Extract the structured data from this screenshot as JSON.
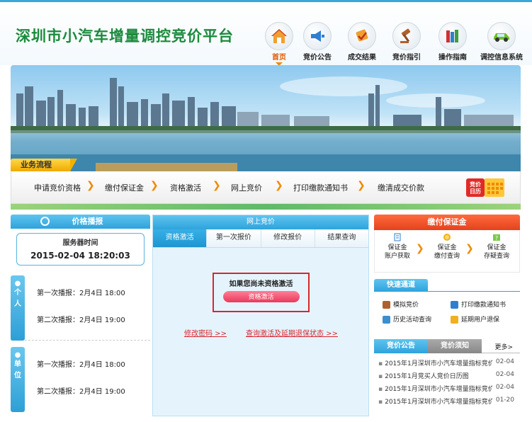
{
  "header": {
    "title": "深圳市小汽车增量调控竞价平台",
    "nav": [
      {
        "label": "首页",
        "icon": "house-icon",
        "active": true
      },
      {
        "label": "竞价公告",
        "icon": "megaphone-icon"
      },
      {
        "label": "成交结果",
        "icon": "trophy-icon"
      },
      {
        "label": "竞价指引",
        "icon": "gavel-icon"
      },
      {
        "label": "操作指南",
        "icon": "books-icon"
      },
      {
        "label": "调控信息系统",
        "icon": "car-icon"
      }
    ]
  },
  "process": {
    "tab_label": "业务流程",
    "steps": [
      "申请竞价资格",
      "缴付保证金",
      "资格激活",
      "网上竞价",
      "打印缴款通知书",
      "缴清成交价款"
    ],
    "calendar_label_1": "竞价",
    "calendar_label_2": "日历"
  },
  "left": {
    "head": "价格播报",
    "server_label": "服务器时间",
    "server_time": "2015-02-04 18:20:03",
    "individual": {
      "tag": [
        "个",
        "人"
      ],
      "first": "第一次播报：2月4日 18:00",
      "second": "第二次播报：2月4日 19:00"
    },
    "unit": {
      "tag": [
        "单",
        "位"
      ],
      "first": "第一次播报：2月4日 18:00",
      "second": "第二次播报：2月4日 19:00"
    }
  },
  "middle": {
    "head": "网上竞价",
    "tabs": [
      "资格激活",
      "第一次报价",
      "修改报价",
      "结果查询"
    ],
    "notice": "如果您尚未资格激活",
    "activate_button": "资格激活",
    "link_change_password": "修改密码 >>",
    "link_query": "查询激活及延期退保状态 >>"
  },
  "right": {
    "deposit_head": "缴付保证金",
    "deposit_items": [
      {
        "line1": "保证金",
        "line2": "账户获取",
        "icon": "document-icon"
      },
      {
        "line1": "保证金",
        "line2": "缴付查询",
        "icon": "coins-icon"
      },
      {
        "line1": "保证金",
        "line2": "存疑查询",
        "icon": "question-icon"
      }
    ],
    "quick_head": "快速通道",
    "quick_items": [
      {
        "label": "模拟竞价",
        "icon": "gavel-icon"
      },
      {
        "label": "打印缴款通知书",
        "icon": "printer-icon"
      },
      {
        "label": "历史活动查询",
        "icon": "calendar-icon"
      },
      {
        "label": "延期用户退保",
        "icon": "copy-icon"
      }
    ],
    "news_tabs": [
      "竞价公告",
      "竞价须知"
    ],
    "more": "更多>",
    "news": [
      {
        "title": "2015年1月深圳市小汽车增量指标竞价的",
        "date": "02-04"
      },
      {
        "title": "2015年1月竞买人竞价日历图",
        "date": "02-04"
      },
      {
        "title": "2015年1月深圳市小汽车增量指标竞价么",
        "date": "02-04"
      },
      {
        "title": "2015年1月深圳市小汽车增量指标竞价么",
        "date": "01-20"
      }
    ]
  },
  "colors": {
    "title_green": "#1b8a3d",
    "accent_blue": "#2ea3dc",
    "orange": "#f08a00",
    "red_border": "#d8262f",
    "deposit_red": "#e4421d"
  }
}
